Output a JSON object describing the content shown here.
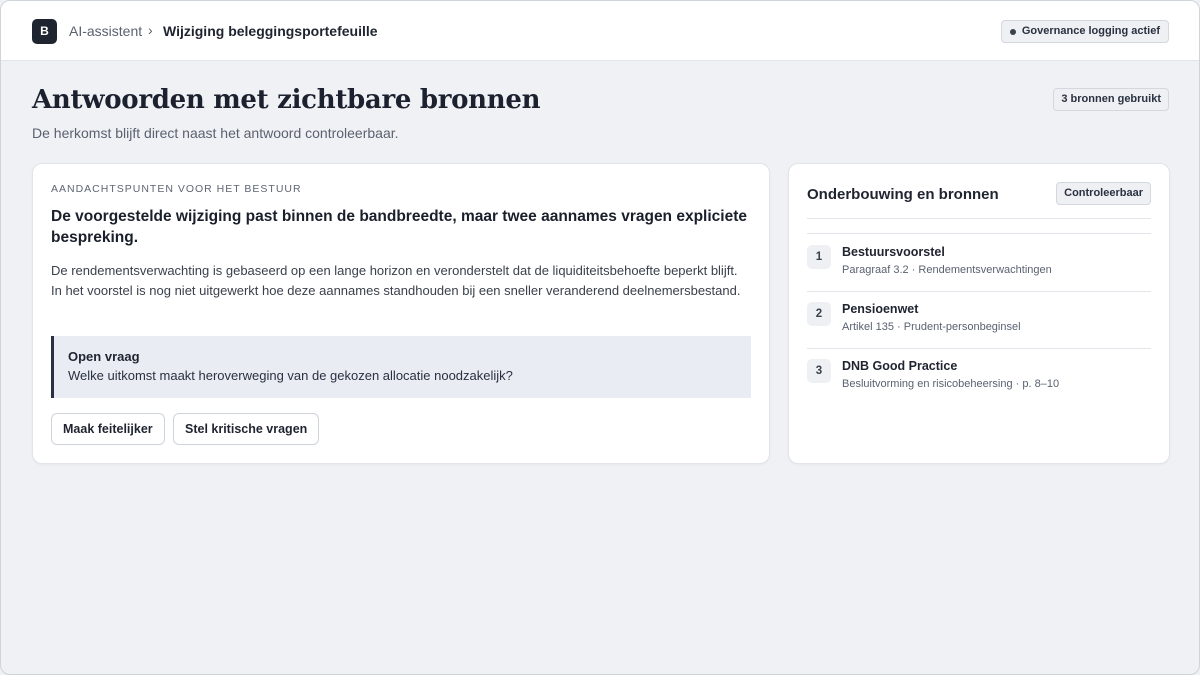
{
  "header": {
    "logo_letter": "B",
    "breadcrumb_root": "AI-assistent",
    "breadcrumb_separator": "›",
    "breadcrumb_current": "Wijziging beleggingsportefeuille",
    "governance_badge": "Governance logging actief"
  },
  "page": {
    "title": "Antwoorden met zichtbare bronnen",
    "subtitle": "De herkomst blijft direct naast het antwoord controleerbaar.",
    "sources_badge": "3 bronnen gebruikt"
  },
  "answer": {
    "eyebrow": "AANDACHTSPUNTEN VOOR HET BESTUUR",
    "headline": "De voorgestelde wijziging past binnen de bandbreedte, maar twee aannames vragen expliciete bespreking.",
    "body": "De rendementsverwachting is gebaseerd op een lange horizon en veronderstelt dat de liquiditeitsbehoefte beperkt blijft. In het voorstel is nog niet uitgewerkt hoe deze aannames standhouden bij een sneller veranderend deelnemersbestand.",
    "open_question_label": "Open vraag",
    "open_question_text": "Welke uitkomst maakt heroverweging van de gekozen allocatie noodzakelijk?",
    "button_factual": "Maak feitelijker",
    "button_critical": "Stel kritische vragen"
  },
  "sources_panel": {
    "title": "Onderbouwing en bronnen",
    "badge": "Controleerbaar",
    "items": [
      {
        "number": "1",
        "name": "Bestuursvoorstel",
        "detail": "Paragraaf 3.2 · Rendementsverwachtingen"
      },
      {
        "number": "2",
        "name": "Pensioenwet",
        "detail": "Artikel 135 · Prudent-personbeginsel"
      },
      {
        "number": "3",
        "name": "DNB Good Practice",
        "detail": "Besluitvorming en risicobeheersing · p. 8–10"
      }
    ]
  }
}
